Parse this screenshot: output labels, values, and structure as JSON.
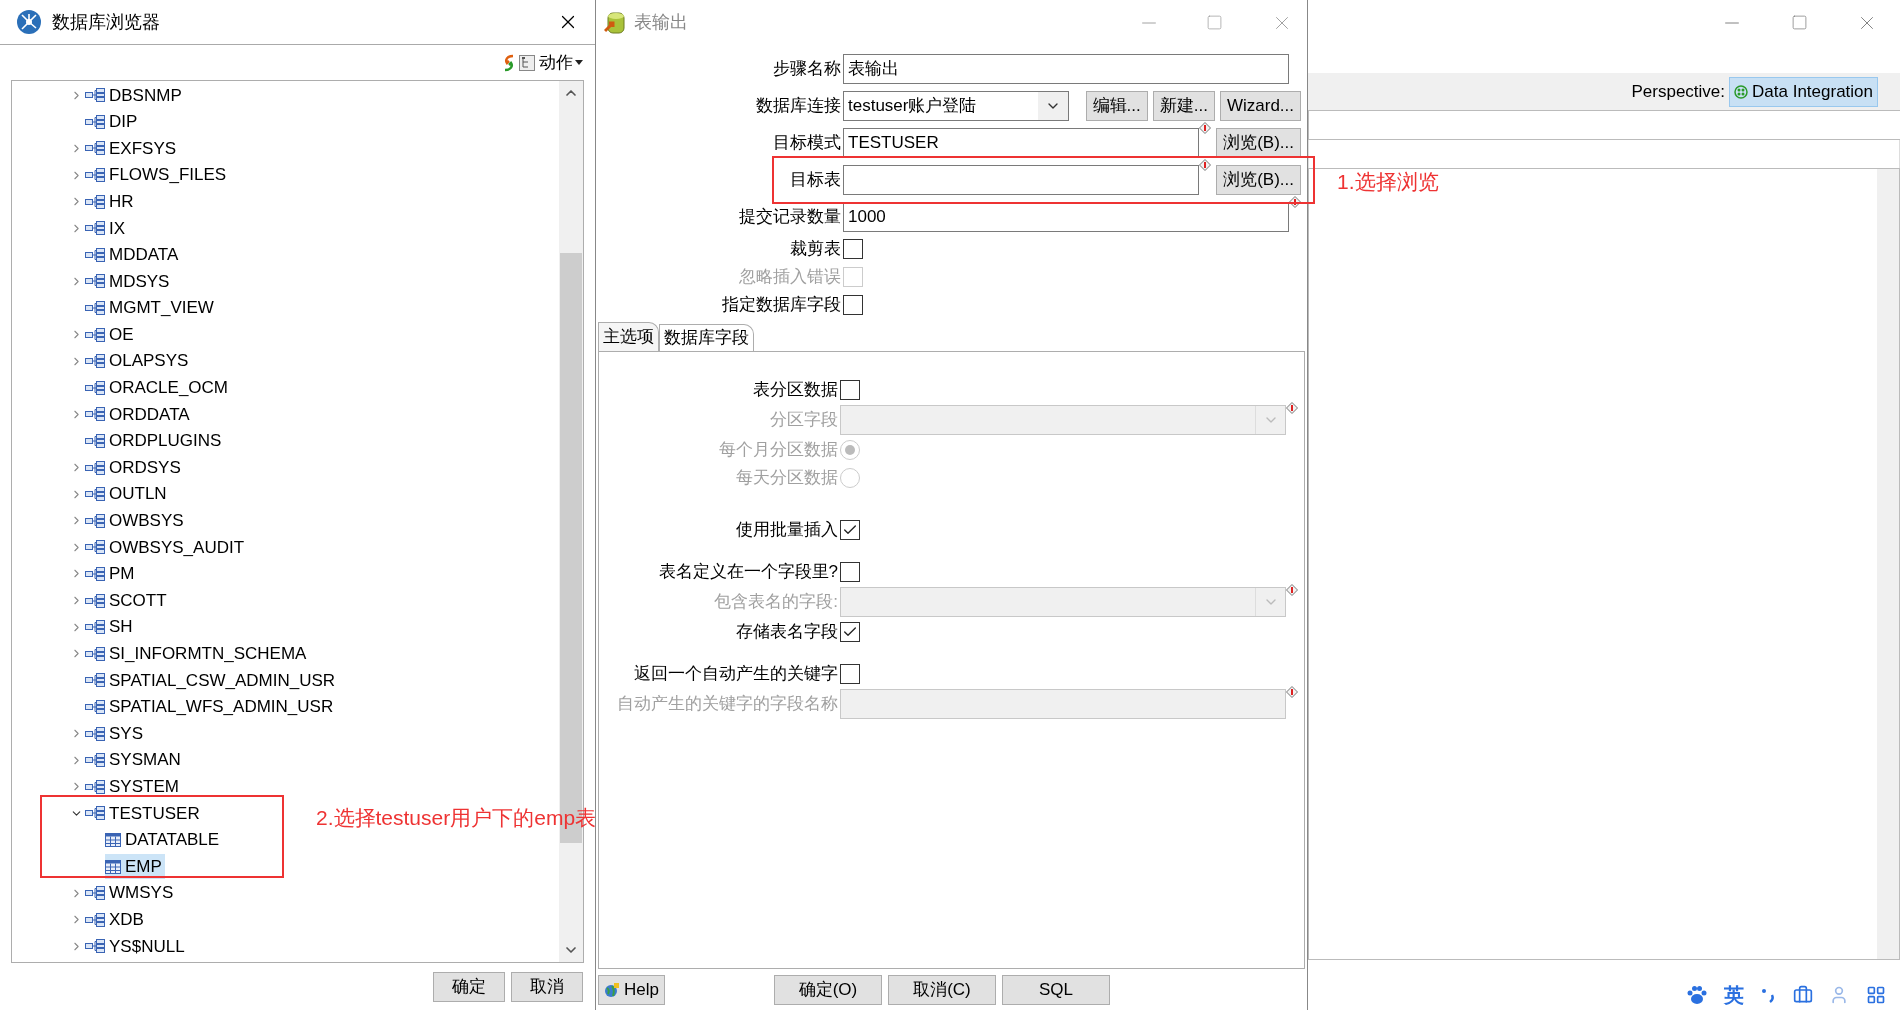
{
  "browser": {
    "title": "数据库浏览器",
    "action_label": "动作",
    "tree": [
      {
        "label": "DBSNMP",
        "kind": "schema",
        "expanded": false,
        "selected": false
      },
      {
        "label": "DIP",
        "kind": "schema",
        "selected": false
      },
      {
        "label": "EXFSYS",
        "kind": "schema",
        "expanded": false,
        "selected": false
      },
      {
        "label": "FLOWS_FILES",
        "kind": "schema",
        "expanded": false,
        "selected": false
      },
      {
        "label": "HR",
        "kind": "schema",
        "expanded": false,
        "selected": false
      },
      {
        "label": "IX",
        "kind": "schema",
        "expanded": false,
        "selected": false
      },
      {
        "label": "MDDATA",
        "kind": "schema",
        "selected": false
      },
      {
        "label": "MDSYS",
        "kind": "schema",
        "expanded": false,
        "selected": false
      },
      {
        "label": "MGMT_VIEW",
        "kind": "schema",
        "selected": false
      },
      {
        "label": "OE",
        "kind": "schema",
        "expanded": false,
        "selected": false
      },
      {
        "label": "OLAPSYS",
        "kind": "schema",
        "expanded": false,
        "selected": false
      },
      {
        "label": "ORACLE_OCM",
        "kind": "schema",
        "selected": false
      },
      {
        "label": "ORDDATA",
        "kind": "schema",
        "expanded": false,
        "selected": false
      },
      {
        "label": "ORDPLUGINS",
        "kind": "schema",
        "selected": false
      },
      {
        "label": "ORDSYS",
        "kind": "schema",
        "expanded": false,
        "selected": false
      },
      {
        "label": "OUTLN",
        "kind": "schema",
        "expanded": false,
        "selected": false
      },
      {
        "label": "OWBSYS",
        "kind": "schema",
        "expanded": false,
        "selected": false
      },
      {
        "label": "OWBSYS_AUDIT",
        "kind": "schema",
        "expanded": false,
        "selected": false
      },
      {
        "label": "PM",
        "kind": "schema",
        "expanded": false,
        "selected": false
      },
      {
        "label": "SCOTT",
        "kind": "schema",
        "expanded": false,
        "selected": false
      },
      {
        "label": "SH",
        "kind": "schema",
        "expanded": false,
        "selected": false
      },
      {
        "label": "SI_INFORMTN_SCHEMA",
        "kind": "schema",
        "expanded": false,
        "selected": false
      },
      {
        "label": "SPATIAL_CSW_ADMIN_USR",
        "kind": "schema",
        "selected": false
      },
      {
        "label": "SPATIAL_WFS_ADMIN_USR",
        "kind": "schema",
        "selected": false
      },
      {
        "label": "SYS",
        "kind": "schema",
        "expanded": false,
        "selected": false
      },
      {
        "label": "SYSMAN",
        "kind": "schema",
        "expanded": false,
        "selected": false
      },
      {
        "label": "SYSTEM",
        "kind": "schema",
        "expanded": false,
        "selected": false
      },
      {
        "label": "TESTUSER",
        "kind": "schema",
        "expanded": true,
        "selected": false,
        "children": [
          {
            "label": "DATATABLE",
            "kind": "table",
            "selected": false
          },
          {
            "label": "EMP",
            "kind": "table",
            "selected": true
          }
        ]
      },
      {
        "label": "WMSYS",
        "kind": "schema",
        "expanded": false,
        "selected": false
      },
      {
        "label": "XDB",
        "kind": "schema",
        "expanded": false,
        "selected": false
      },
      {
        "label": "YS$NULL",
        "kind": "schema",
        "expanded": false,
        "selected": false
      }
    ],
    "buttons": [
      "确定",
      "取消"
    ]
  },
  "dialog": {
    "title": "表输出",
    "fields": [
      {
        "kind": "text",
        "label": "步骤名称",
        "value": "表输出",
        "disabled": false
      },
      {
        "kind": "combo",
        "label": "数据库连接",
        "value": "testuser账户登陆",
        "disabled": false,
        "buttons": [
          "编辑...",
          "新建...",
          "Wizard..."
        ]
      },
      {
        "kind": "text",
        "label": "目标模式",
        "value": "TESTUSER",
        "required": true,
        "disabled": false,
        "buttons": [
          "浏览(B)..."
        ]
      },
      {
        "kind": "text",
        "label": "目标表",
        "required": true,
        "disabled": false,
        "buttons": [
          "浏览(B)..."
        ]
      },
      {
        "kind": "text",
        "label": "提交记录数量",
        "value": "1000",
        "required": true,
        "disabled": false
      },
      {
        "kind": "check",
        "label": "裁剪表",
        "checked": false,
        "disabled": false
      },
      {
        "kind": "check",
        "label": "忽略插入错误",
        "checked": false,
        "disabled": true
      },
      {
        "kind": "check",
        "label": "指定数据库字段",
        "checked": false,
        "disabled": false
      }
    ],
    "tabs": [
      {
        "label": "主选项",
        "selected": true
      },
      {
        "label": "数据库字段",
        "selected": false
      }
    ],
    "option_groups": [
      [
        {
          "kind": "check",
          "label": "表分区数据",
          "checked": false,
          "disabled": false
        },
        {
          "kind": "combo",
          "label": "分区字段",
          "required": true,
          "disabled": true
        },
        {
          "kind": "radio",
          "label": "每个月分区数据",
          "selected": true,
          "disabled": true
        },
        {
          "kind": "radio",
          "label": "每天分区数据",
          "selected": false,
          "disabled": true
        }
      ],
      [
        {
          "kind": "check",
          "label": "使用批量插入",
          "checked": true,
          "disabled": false
        }
      ],
      [
        {
          "kind": "check",
          "label": "表名定义在一个字段里?",
          "checked": false,
          "disabled": false
        },
        {
          "kind": "combo",
          "label": "包含表名的字段:",
          "required": true,
          "disabled": true
        },
        {
          "kind": "check",
          "label": "存储表名字段",
          "checked": true,
          "disabled": false
        }
      ],
      [
        {
          "kind": "check",
          "label": "返回一个自动产生的关键字",
          "checked": false,
          "disabled": false
        },
        {
          "kind": "text",
          "label": "自动产生的关键字的字段名称",
          "required": true,
          "disabled": true
        }
      ]
    ],
    "help": "Help",
    "buttons": [
      "确定(O)",
      "取消(C)",
      "SQL"
    ]
  },
  "main_window": {
    "perspective_label": "Perspective:",
    "perspective": "Data Integration"
  },
  "annotations": [
    {
      "text": "1.选择浏览"
    },
    {
      "text": "2.选择testuser用户下的emp表"
    }
  ],
  "ime": {
    "mode": "英"
  }
}
